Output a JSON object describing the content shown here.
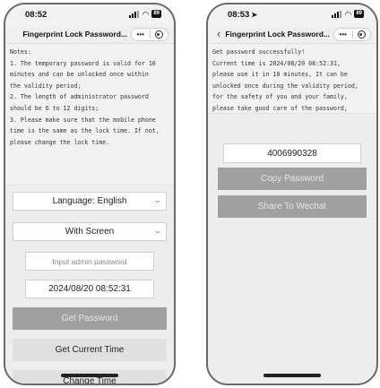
{
  "left": {
    "status": {
      "time": "08:52",
      "battery": "89"
    },
    "nav": {
      "title": "Fingerprint Lock Password...",
      "more": "•••"
    },
    "notes": [
      "Notes:",
      "1. The temporary password is valid for 10",
      "minutes and can be unlocked once within",
      "the validity period;",
      "2. The length of administrator password",
      "should be 6 to 12 digits;",
      "3. Please make sure that the mobile phone",
      "time is the same as the lock time. If not,",
      "please change the lock time."
    ],
    "language": "Language: English",
    "screen_mode": "With Screen",
    "admin_password_placeholder": "Input admin password",
    "time_value": "2024/08/20 08:52:31",
    "get_password": "Get Password",
    "get_current_time": "Get Current Time",
    "change_time": "Change Time"
  },
  "right": {
    "status": {
      "time": "08:53",
      "battery": "89"
    },
    "nav": {
      "title": "Fingerprint Lock Password...",
      "more": "•••"
    },
    "message": [
      "Get password successfully!",
      "Current time is 2024/08/20 08:52:31,",
      "please use it in 10 minutes, It can be",
      "unlocked once during the validity period,",
      "for the safety of you and your family,",
      "please take good care of the password,"
    ],
    "password": "4006990328",
    "copy_password": "Copy Password",
    "share_wechat": "Share To Wechat"
  },
  "icons": [
    "signal-icon",
    "wifi-icon",
    "battery-icon",
    "back-icon",
    "more-icon",
    "close-miniprogram-icon",
    "chevron-down-icon",
    "location-arrow-icon"
  ]
}
